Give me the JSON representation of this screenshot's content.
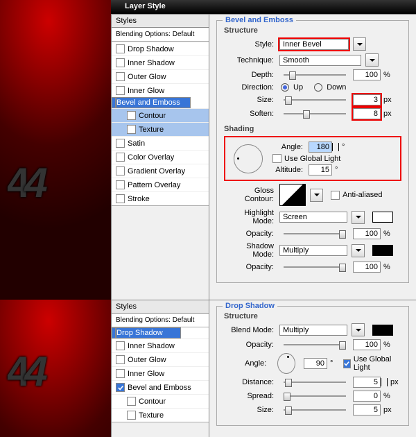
{
  "title": "Layer Style",
  "styles_hd": "Styles",
  "styles_sub": "Blending Options: Default",
  "panel1": {
    "items": [
      {
        "label": "Drop Shadow",
        "checked": false,
        "selected": false
      },
      {
        "label": "Inner Shadow",
        "checked": false,
        "selected": false
      },
      {
        "label": "Outer Glow",
        "checked": false,
        "selected": false
      },
      {
        "label": "Inner Glow",
        "checked": false,
        "selected": false
      },
      {
        "label": "Bevel and Emboss",
        "checked": true,
        "selected": true
      },
      {
        "label": "Contour",
        "checked": false,
        "indentsel": true
      },
      {
        "label": "Texture",
        "checked": false,
        "indentsel": true
      },
      {
        "label": "Satin",
        "checked": false
      },
      {
        "label": "Color Overlay",
        "checked": false
      },
      {
        "label": "Gradient Overlay",
        "checked": false
      },
      {
        "label": "Pattern Overlay",
        "checked": false
      },
      {
        "label": "Stroke",
        "checked": false
      }
    ],
    "legend": "Bevel and Emboss",
    "structure": {
      "sub": "Structure",
      "style_lab": "Style:",
      "style_val": "Inner Bevel",
      "tech_lab": "Technique:",
      "tech_val": "Smooth",
      "depth_lab": "Depth:",
      "depth_val": "100",
      "depth_unit": "%",
      "dir_lab": "Direction:",
      "dir_up": "Up",
      "dir_down": "Down",
      "size_lab": "Size:",
      "size_val": "3",
      "size_unit": "px",
      "soften_lab": "Soften:",
      "soften_val": "8",
      "soften_unit": "px"
    },
    "shading": {
      "sub": "Shading",
      "angle_lab": "Angle:",
      "angle_val": "180",
      "angle_unit": "°",
      "ugl": "Use Global Light",
      "alt_lab": "Altitude:",
      "alt_val": "15",
      "alt_unit": "°",
      "gloss_lab": "Gloss Contour:",
      "anti": "Anti-aliased",
      "hl_lab": "Highlight Mode:",
      "hl_val": "Screen",
      "hl_color": "#ffffff",
      "op1_lab": "Opacity:",
      "op1_val": "100",
      "op_unit": "%",
      "sh_lab": "Shadow Mode:",
      "sh_val": "Multiply",
      "sh_color": "#000000",
      "op2_val": "100"
    }
  },
  "panel2": {
    "items": [
      {
        "label": "Drop Shadow",
        "checked": true,
        "selected": true
      },
      {
        "label": "Inner Shadow",
        "checked": false
      },
      {
        "label": "Outer Glow",
        "checked": false
      },
      {
        "label": "Inner Glow",
        "checked": false
      },
      {
        "label": "Bevel and Emboss",
        "checked": true
      },
      {
        "label": "Contour",
        "checked": false,
        "indent": true
      },
      {
        "label": "Texture",
        "checked": false,
        "indent": true
      }
    ],
    "legend": "Drop Shadow",
    "structure": {
      "sub": "Structure",
      "blend_lab": "Blend Mode:",
      "blend_val": "Multiply",
      "blend_color": "#000000",
      "op_lab": "Opacity:",
      "op_val": "100",
      "op_unit": "%",
      "angle_lab": "Angle:",
      "angle_val": "90",
      "angle_unit": "°",
      "ugl": "Use Global Light",
      "dist_lab": "Distance:",
      "dist_val": "5",
      "dist_unit": "px",
      "spread_lab": "Spread:",
      "spread_val": "0",
      "spread_unit": "%",
      "size_lab": "Size:",
      "size_val": "5",
      "size_unit": "px"
    }
  },
  "fortyfour": "44"
}
